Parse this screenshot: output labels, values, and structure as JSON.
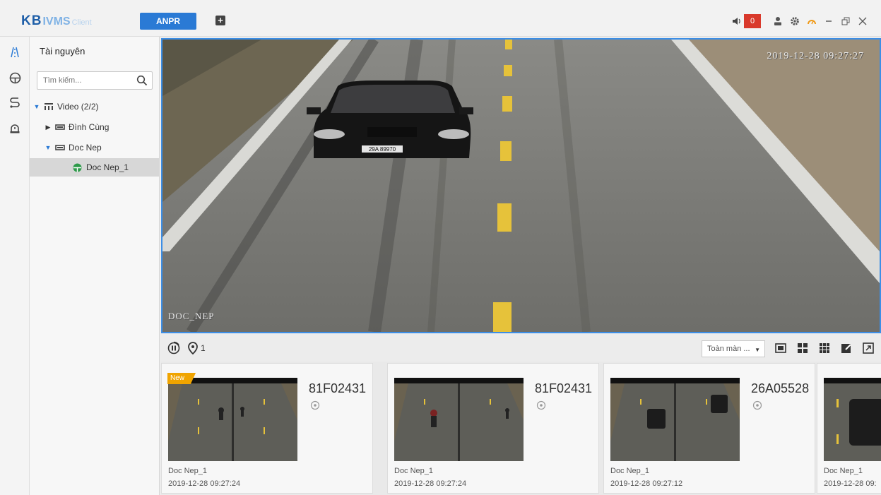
{
  "app": {
    "logo_kb": "KB",
    "logo_ivms": "IVMS",
    "logo_client": "Client",
    "active_tab": "ANPR",
    "alarm_count": "0",
    "accent_color": "#2a7ad5",
    "alarm_color": "#d9392b"
  },
  "sidebar_rail": [
    "resources-icon",
    "anpr-icon",
    "route-icon",
    "alarm-icon"
  ],
  "panel": {
    "title": "Tài nguyên",
    "search_placeholder": "Tìm kiếm...",
    "tree": {
      "root": "Video (2/2)",
      "group1": "Đình Cùng",
      "group2": "Doc Nep",
      "camera": "Doc Nep_1"
    }
  },
  "video": {
    "osd_time": "2019-12-28 09:27:27",
    "osd_name": "DOC_NEP",
    "plate_on_car": "29A 89970"
  },
  "toolbar": {
    "location_count": "1",
    "display_mode": "Toàn màn ..."
  },
  "captures": [
    {
      "badge": "New",
      "plate": "81F02431",
      "camera": "Doc Nep_1",
      "time": "2019-12-28 09:27:24"
    },
    {
      "badge": "",
      "plate": "81F02431",
      "camera": "Doc Nep_1",
      "time": "2019-12-28 09:27:24"
    },
    {
      "badge": "",
      "plate": "26A05528",
      "camera": "Doc Nep_1",
      "time": "2019-12-28 09:27:12"
    },
    {
      "badge": "",
      "plate": "",
      "camera": "Doc Nep_1",
      "time": "2019-12-28 09:"
    }
  ]
}
